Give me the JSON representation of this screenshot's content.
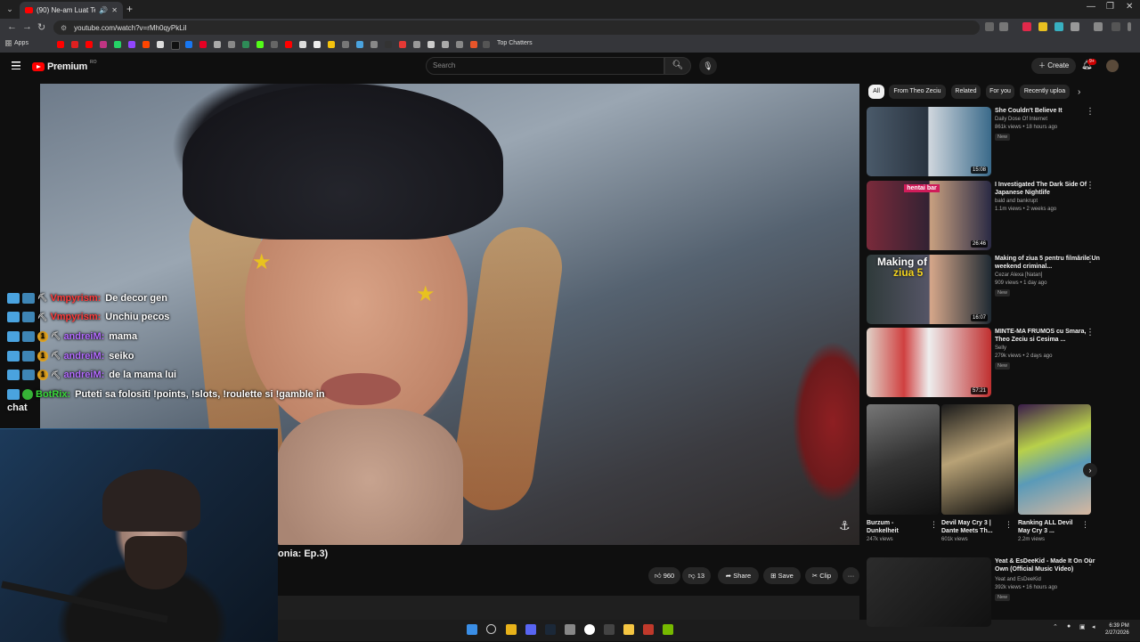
{
  "browser": {
    "tab_title": "(90) Ne-am Luat Teapa La T",
    "url": "youtube.com/watch?v=rMh0qyPkLiI",
    "bookmarks_apps": "Apps",
    "bookmark_top": "Top Chatters"
  },
  "header": {
    "logo_text": "Premium",
    "logo_region": "RO",
    "search_placeholder": "Search",
    "create_label": "Create",
    "notif_count": "9+"
  },
  "chat": {
    "messages": [
      {
        "user": "Vmpyrism:",
        "text": "De decor gen",
        "color": "#ff3b3b"
      },
      {
        "user": "Vmpyrism:",
        "text": "Unchiu pecos",
        "color": "#ff3b3b"
      },
      {
        "user": "andreiM:",
        "text": "mama",
        "color": "#b36bff"
      },
      {
        "user": "andreiM:",
        "text": "seiko",
        "color": "#b36bff"
      },
      {
        "user": "andreiM:",
        "text": "de la mama lui",
        "color": "#b36bff"
      },
      {
        "user": "BotRix:",
        "text": "Puteti sa folositi !points, !slots, !roulette si !gamble in",
        "color": "#3ad93a"
      }
    ],
    "wrap_text": "chat",
    "gold_badge": "1"
  },
  "video": {
    "title_fragment": "onia: Ep.3)",
    "like_count": "960",
    "dislike_count": "13",
    "share_label": "Share",
    "save_label": "Save",
    "clip_label": "Clip",
    "more_label": "···"
  },
  "filters": [
    "All",
    "From Theo Zeciu",
    "Related",
    "For you",
    "Recently uploa"
  ],
  "recommendations": [
    {
      "title": "She Couldn't Believe It",
      "channel": "Daily Dose Of Internet",
      "stats": "861k views • 18 hours ago",
      "badge": "New",
      "duration": "15:08"
    },
    {
      "title": "I Investigated The Dark Side Of Japanese Nightlife",
      "channel": "bald and bankrupt",
      "stats": "1.1m views • 2 weeks ago",
      "badge": "",
      "duration": "26:46"
    },
    {
      "title": "Making of ziua 5 pentru filmările Un weekend criminal...",
      "channel": "Cezar Alexa [Natan]",
      "stats": "909 views • 1 day ago",
      "badge": "New",
      "duration": "16:07"
    },
    {
      "title": "MINTE-MA FRUMOS cu Smara, Theo Zeciu si Cesima ...",
      "channel": "Selly",
      "stats": "279k views • 2 days ago",
      "badge": "New",
      "duration": "57:21"
    }
  ],
  "thumb_text": {
    "hentai_bar": "hentai bar",
    "making_of": "Making of",
    "ziua5": "ziua 5"
  },
  "shorts": [
    {
      "title": "Burzum - Dunkelheit",
      "views": "247k views"
    },
    {
      "title": "Devil May Cry 3 | Dante Meets Th...",
      "views": "601k views"
    },
    {
      "title": "Ranking ALL Devil May Cry 3 ...",
      "views": "2.2m views"
    }
  ],
  "rec_bottom": {
    "title": "Yeat & EsDeeKid - Made It On Our Own (Official Music Video)",
    "channel": "Yeat and EsDeeKid",
    "stats": "392k views • 16 hours ago",
    "badge": "New"
  },
  "taskbar": {
    "time": "6:39 PM",
    "date": "2/27/2026"
  }
}
